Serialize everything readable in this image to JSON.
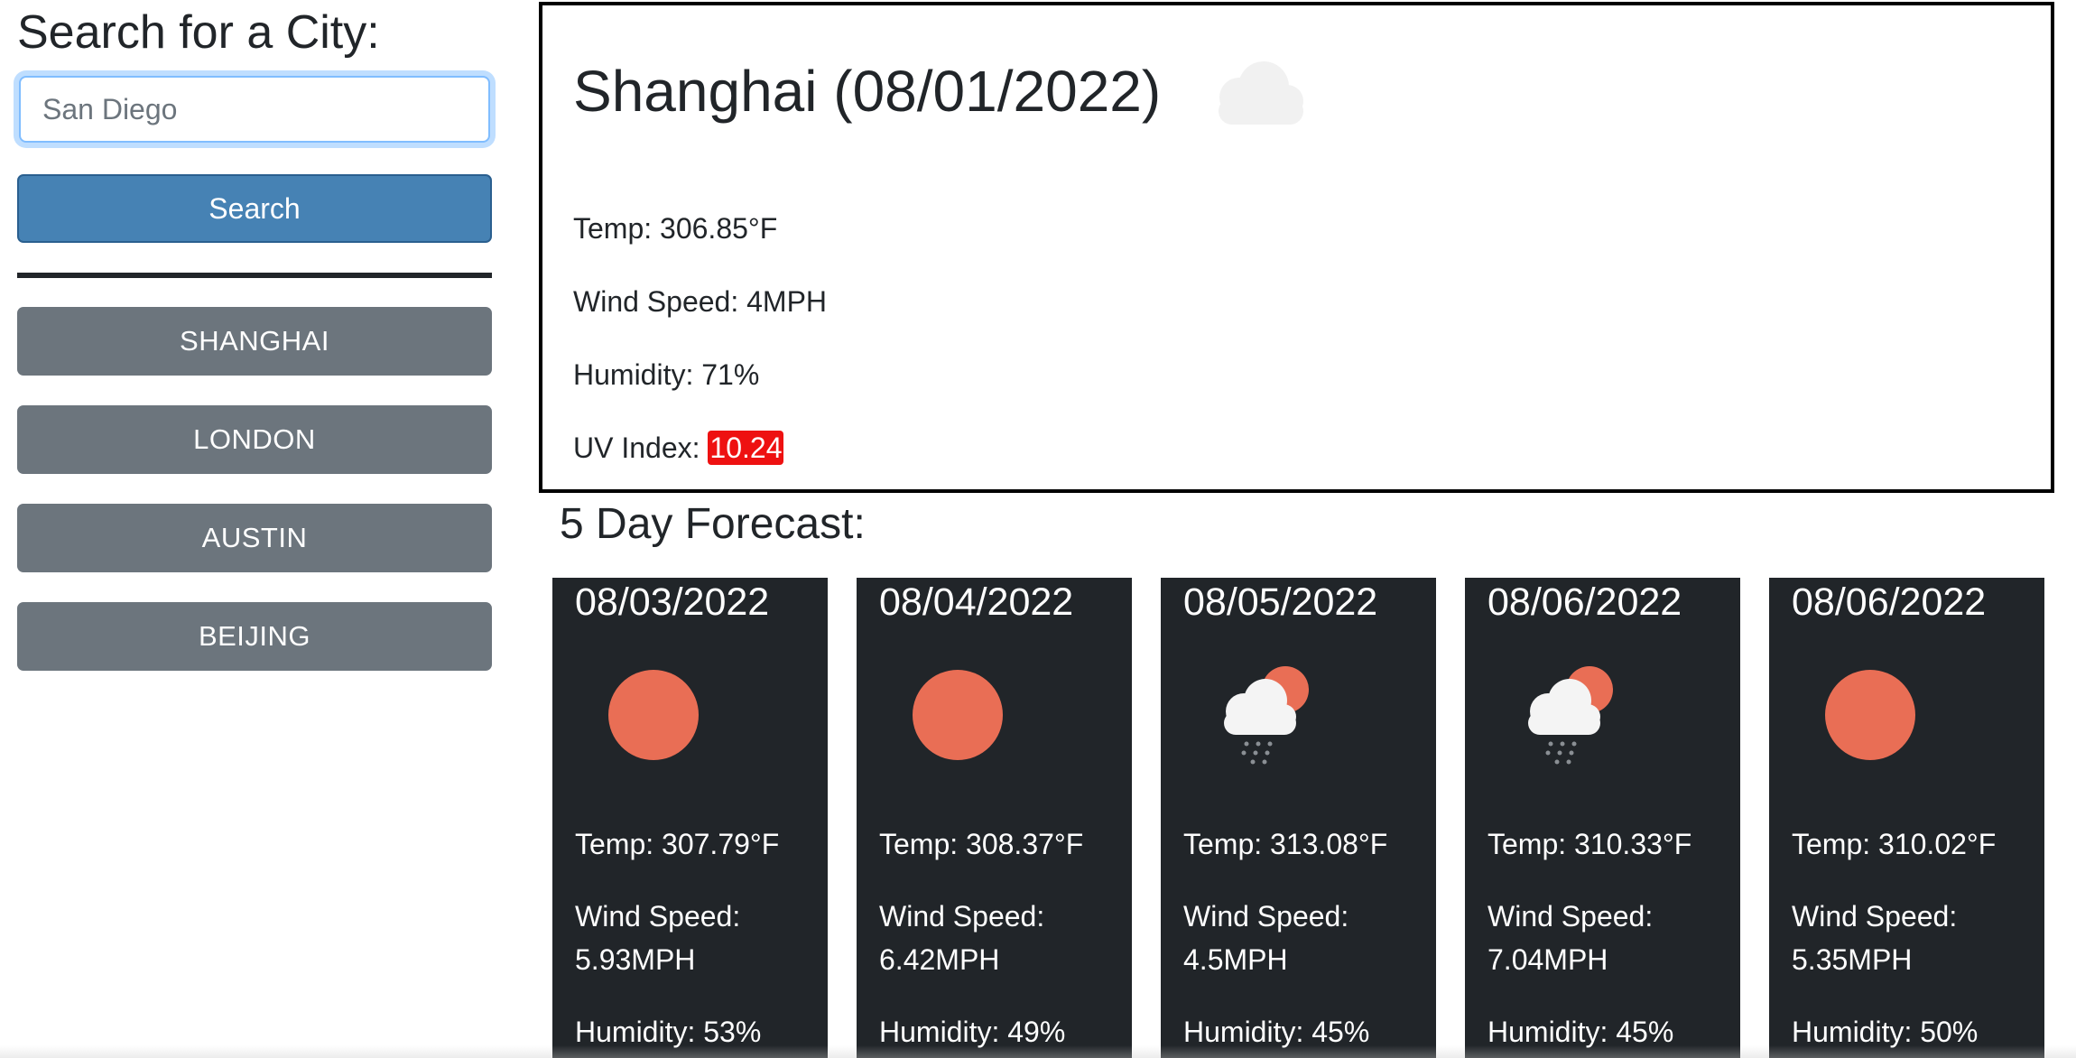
{
  "sidebar": {
    "title": "Search for a City:",
    "search": {
      "value": "San Diego",
      "placeholder": "San Diego"
    },
    "search_button": "Search",
    "history": [
      "SHANGHAI",
      "LONDON",
      "AUSTIN",
      "BEIJING"
    ]
  },
  "current": {
    "title": "Shanghai (08/01/2022)",
    "icon": "cloud-icon",
    "temp": "Temp: 306.85°F",
    "wind": "Wind Speed: 4MPH",
    "humidity": "Humidity: 71%",
    "uv_label": "UV Index: ",
    "uv_value": "10.24",
    "uv_color": "#ee1111"
  },
  "forecast": {
    "title": "5 Day Forecast:",
    "days": [
      {
        "date": "08/03/2022",
        "icon": "sun-icon",
        "temp": "Temp: 307.79°F",
        "wind_label": "Wind Speed:",
        "wind_value": "5.93MPH",
        "humidity": "Humidity: 53%"
      },
      {
        "date": "08/04/2022",
        "icon": "sun-icon",
        "temp": "Temp: 308.37°F",
        "wind_label": "Wind Speed:",
        "wind_value": "6.42MPH",
        "humidity": "Humidity: 49%"
      },
      {
        "date": "08/05/2022",
        "icon": "rain-cloud-sun-icon",
        "temp": "Temp: 313.08°F",
        "wind_label": "Wind Speed:",
        "wind_value": "4.5MPH",
        "humidity": "Humidity: 45%"
      },
      {
        "date": "08/06/2022",
        "icon": "rain-cloud-sun-icon",
        "temp": "Temp: 310.33°F",
        "wind_label": "Wind Speed:",
        "wind_value": "7.04MPH",
        "humidity": "Humidity: 45%"
      },
      {
        "date": "08/06/2022",
        "icon": "sun-icon",
        "temp": "Temp: 310.02°F",
        "wind_label": "Wind Speed:",
        "wind_value": "5.35MPH",
        "humidity": "Humidity: 50%"
      }
    ]
  },
  "colors": {
    "search_button": "#4682b4",
    "history_button": "#6c757d",
    "forecast_card": "#212529",
    "sun": "#e96e55"
  }
}
